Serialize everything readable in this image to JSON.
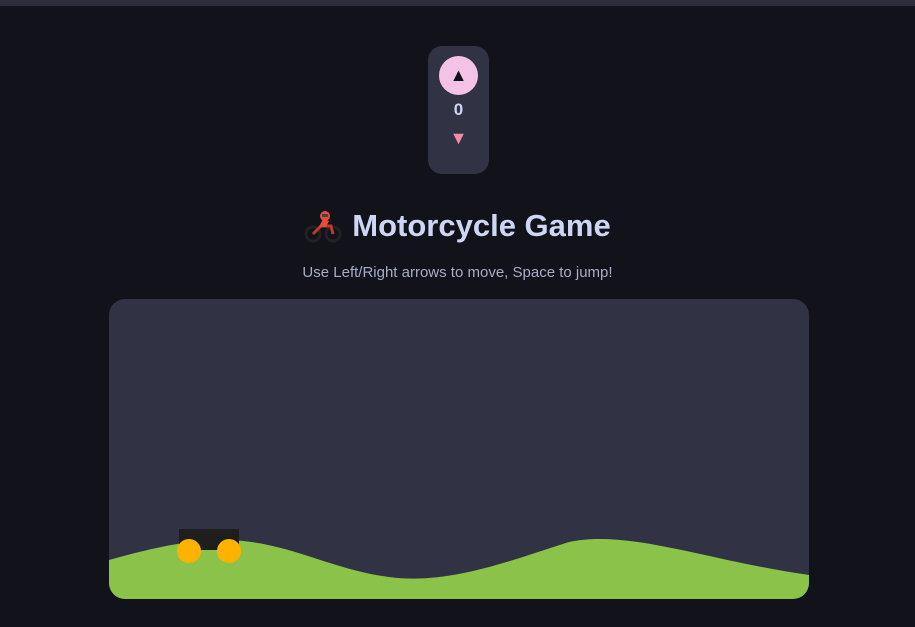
{
  "voter": {
    "up_glyph": "▲",
    "count": "0",
    "down_glyph": "▼"
  },
  "header": {
    "title": "Motorcycle Game",
    "title_icon": "motorcycle-emoji-icon",
    "subtitle": "Use Left/Right arrows to move, Space to jump!"
  },
  "game": {
    "colors": {
      "background": "#313244",
      "ground": "#8bc34a",
      "bike_body": "#1e1e1e",
      "wheels": "#ffb300"
    }
  }
}
